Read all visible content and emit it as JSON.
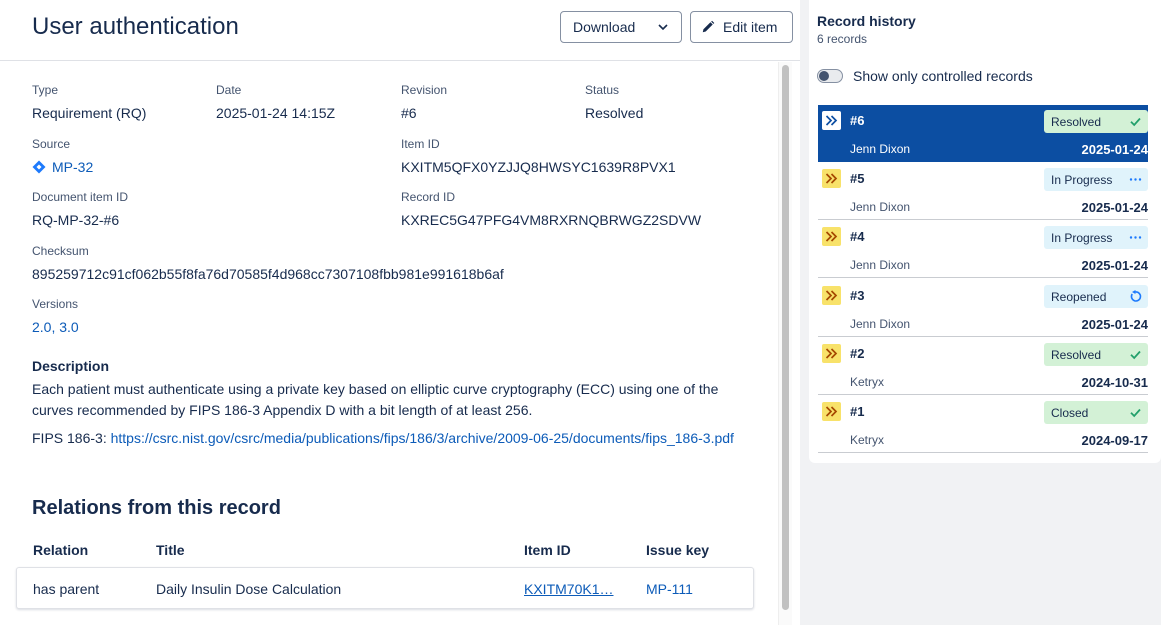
{
  "header": {
    "title": "User authentication",
    "download_label": "Download",
    "edit_label": "Edit item"
  },
  "details": {
    "type_label": "Type",
    "type_value": "Requirement (RQ)",
    "date_label": "Date",
    "date_value": "2025-01-24 14:15Z",
    "revision_label": "Revision",
    "revision_value": "#6",
    "status_label": "Status",
    "status_value": "Resolved",
    "source_label": "Source",
    "source_value": "MP-32",
    "item_id_label": "Item ID",
    "item_id_value": "KXITM5QFX0YZJJQ8HWSYC1639R8PVX1",
    "doc_item_id_label": "Document item ID",
    "doc_item_id_value": "RQ-MP-32-#6",
    "record_id_label": "Record ID",
    "record_id_value": "KXREC5G47PFG4VM8RXRNQBRWGZ2SDVW",
    "checksum_label": "Checksum",
    "checksum_value": "895259712c91cf062b55f8fa76d70585f4d968cc7307108fbb981e991618b6af",
    "versions_label": "Versions",
    "version_1": "2.0",
    "version_sep": ", ",
    "version_2": "3.0"
  },
  "description": {
    "heading": "Description",
    "text": "Each patient must authenticate using a private key based on elliptic curve cryptography (ECC) using one of the curves recommended by FIPS 186-3 Appendix D with a bit length of at least 256.",
    "fips_prefix": "FIPS 186-3: ",
    "fips_link": "https://csrc.nist.gov/csrc/media/publications/fips/186/3/archive/2009-06-25/documents/fips_186-3.pdf"
  },
  "relations": {
    "heading": "Relations from this record",
    "columns": [
      "Relation",
      "Title",
      "Item ID",
      "Issue key"
    ],
    "rows": [
      {
        "relation": "has parent",
        "title": "Daily Insulin Dose Calculation",
        "item_id": "KXITM70K1…",
        "issue_key": "MP-111"
      }
    ]
  },
  "history": {
    "title": "Record history",
    "count": "6 records",
    "toggle_label": "Show only controlled records",
    "records": [
      {
        "num": "#6",
        "status": "Resolved",
        "status_kind": "check",
        "user": "Jenn Dixon",
        "date": "2025-01-24"
      },
      {
        "num": "#5",
        "status": "In Progress",
        "status_kind": "dots",
        "user": "Jenn Dixon",
        "date": "2025-01-24"
      },
      {
        "num": "#4",
        "status": "In Progress",
        "status_kind": "dots",
        "user": "Jenn Dixon",
        "date": "2025-01-24"
      },
      {
        "num": "#3",
        "status": "Reopened",
        "status_kind": "reopen",
        "user": "Jenn Dixon",
        "date": "2025-01-24"
      },
      {
        "num": "#2",
        "status": "Resolved",
        "status_kind": "check",
        "user": "Ketryx",
        "date": "2024-10-31"
      },
      {
        "num": "#1",
        "status": "Closed",
        "status_kind": "check",
        "user": "Ketryx",
        "date": "2024-09-17"
      }
    ]
  },
  "colors": {
    "selected_bg": "#0c4ea2",
    "link": "#0c5bb8",
    "badge_green": "#d3f1d6",
    "badge_blue": "#e0f3fb",
    "chevron_badge": "#f8e26a"
  }
}
